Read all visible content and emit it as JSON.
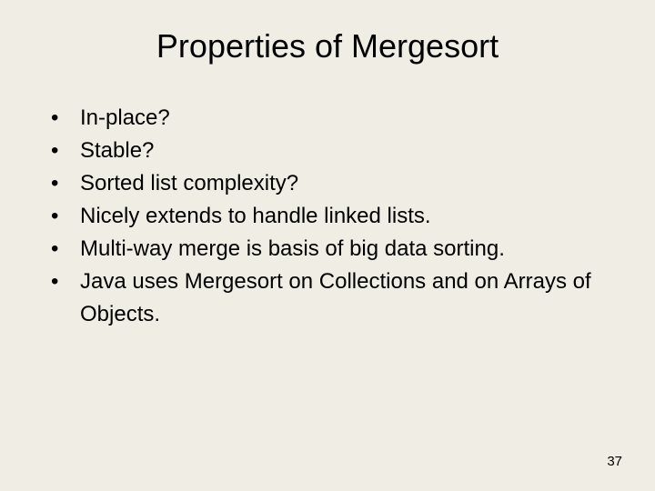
{
  "title": "Properties of Mergesort",
  "bullets": [
    "In-place?",
    "Stable?",
    "Sorted list complexity?",
    "Nicely extends to handle linked lists.",
    "Multi-way merge is basis of big data sorting.",
    "Java uses Mergesort on Collections and on Arrays of Objects."
  ],
  "pageNumber": "37"
}
